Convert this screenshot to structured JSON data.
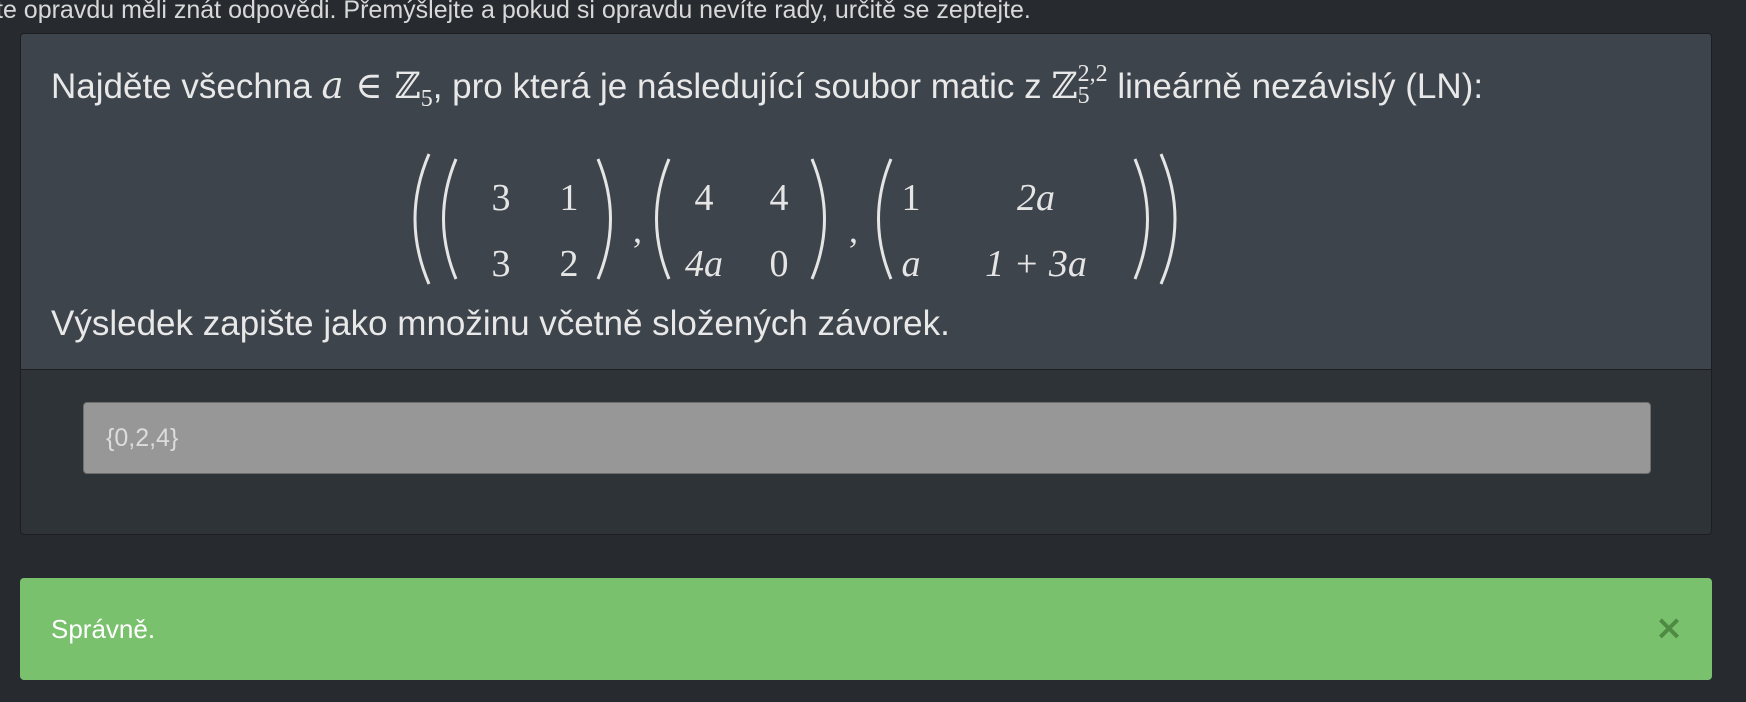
{
  "header": {
    "instruction_text": "te opravdu měli znát odpovědi. Přemýšlejte a pokud si opravdu nevíte rady, určitě se zeptejte."
  },
  "question": {
    "prompt_before": "Najděte všechna ",
    "var_a": "a",
    "elem_symbol": " ∈ ",
    "zz_symbol": "ℤ",
    "z_subscript": "5",
    "prompt_middle": ", pro která je následující soubor matic z ",
    "zz_symbol2": "ℤ",
    "z2_superscript": "2,2",
    "z2_subscript": "5",
    "prompt_after": " lineárně nezávislý (LN):",
    "matrices": [
      [
        [
          "3",
          "1"
        ],
        [
          "3",
          "2"
        ]
      ],
      [
        [
          "4",
          "4"
        ],
        [
          "4a",
          "0"
        ]
      ],
      [
        [
          "1",
          "2a"
        ],
        [
          "a",
          "1 + 3a"
        ]
      ]
    ],
    "instruction": "Výsledek zapište jako množinu včetně složených závorek."
  },
  "answer": {
    "value": "{0,2,4}"
  },
  "alert": {
    "message": "Správně.",
    "close_symbol": "×"
  },
  "colors": {
    "background": "#272b30",
    "panel_head": "#3e444c",
    "panel_body": "#2e3338",
    "input_bg": "#979797",
    "success": "#7ac16e",
    "success_close": "#4e8a43"
  }
}
